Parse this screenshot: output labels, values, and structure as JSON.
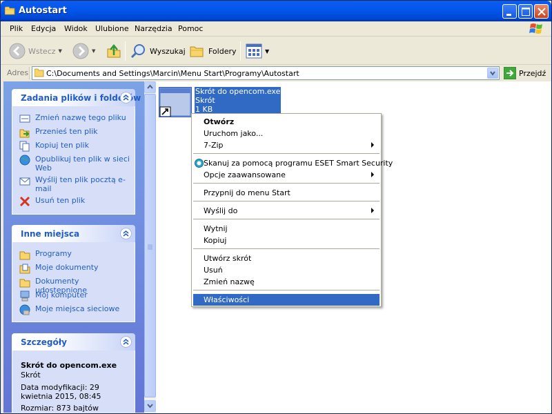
{
  "window": {
    "title": "Autostart"
  },
  "menubar": {
    "items": [
      "Plik",
      "Edycja",
      "Widok",
      "Ulubione",
      "Narzędzia",
      "Pomoc"
    ]
  },
  "toolbar": {
    "back_label": "Wstecz",
    "search_label": "Wyszukaj",
    "folders_label": "Foldery"
  },
  "address": {
    "label": "Adres",
    "path": "C:\\Documents and Settings\\Marcin\\Menu Start\\Programy\\Autostart",
    "go_label": "Przejdź"
  },
  "file_tasks": {
    "title": "Zadania plików i folderów",
    "items": [
      {
        "label": "Zmień nazwę tego pliku"
      },
      {
        "label": "Przenieś ten plik"
      },
      {
        "label": "Kopiuj ten plik"
      },
      {
        "label": "Opublikuj ten plik w sieci Web"
      },
      {
        "label": "Wyślij ten plik pocztą e-mail"
      },
      {
        "label": "Usuń ten plik"
      }
    ]
  },
  "other_places": {
    "title": "Inne miejsca",
    "items": [
      {
        "label": "Programy"
      },
      {
        "label": "Moje dokumenty"
      },
      {
        "label": "Dokumenty udostępnione"
      },
      {
        "label": "Mój komputer"
      },
      {
        "label": "Moje miejsca sieciowe"
      }
    ]
  },
  "details": {
    "title": "Szczegóły",
    "name": "Skrót do opencom.exe",
    "type": "Skrót",
    "modified": "Data modyfikacji: 29 kwietnia 2015, 08:45",
    "size": "Rozmiar: 873 bajtów"
  },
  "file": {
    "name": "Skrót do opencom.exe",
    "type": "Skrót",
    "size": "1 KB"
  },
  "context_menu": {
    "open": "Otwórz",
    "run_as": "Uruchom jako...",
    "zip": "7-Zip",
    "eset_scan": "Skanuj za pomocą programu ESET Smart Security",
    "advanced": "Opcje zaawansowane",
    "pin_start": "Przypnij do menu Start",
    "send_to": "Wyślij do",
    "cut": "Wytnij",
    "copy": "Kopiuj",
    "create_shortcut": "Utwórz skrót",
    "delete": "Usuń",
    "rename": "Zmień nazwę",
    "properties": "Właściwości"
  },
  "colors": {
    "title_blue": "#0155e8",
    "selection": "#316ac5",
    "task_link": "#215dc6"
  }
}
